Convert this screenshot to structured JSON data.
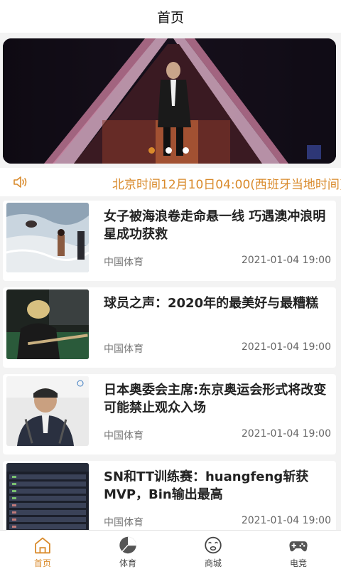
{
  "header": {
    "title": "首页"
  },
  "banner": {
    "slide_count": 3,
    "active_index": 0
  },
  "notice": {
    "icon": "speaker-icon",
    "text": "北京时间12月10日04:00(西班牙当地时间)"
  },
  "news": [
    {
      "title": "女子被海浪卷走命悬一线 巧遇澳冲浪明星成功获救",
      "source": "中国体育",
      "time": "2021-01-04 19:00"
    },
    {
      "title": "球员之声：2020年的最美好与最糟糕",
      "source": "中国体育",
      "time": "2021-01-04 19:00"
    },
    {
      "title": "日本奥委会主席:东京奥运会形式将改变 可能禁止观众入场",
      "source": "中国体育",
      "time": "2021-01-04 19:00"
    },
    {
      "title": "SN和TT训练赛：huangfeng斩获MVP，Bin输出最高",
      "source": "中国体育",
      "time": "2021-01-04 19:00"
    }
  ],
  "tabbar": {
    "items": [
      {
        "label": "首页",
        "icon": "home-icon",
        "active": true
      },
      {
        "label": "体育",
        "icon": "pie-chart-icon",
        "active": false
      },
      {
        "label": "商城",
        "icon": "face-icon",
        "active": false
      },
      {
        "label": "电竞",
        "icon": "gamepad-icon",
        "active": false
      }
    ]
  },
  "colors": {
    "accent": "#d98a2b",
    "text": "#222222",
    "muted": "#777777"
  }
}
